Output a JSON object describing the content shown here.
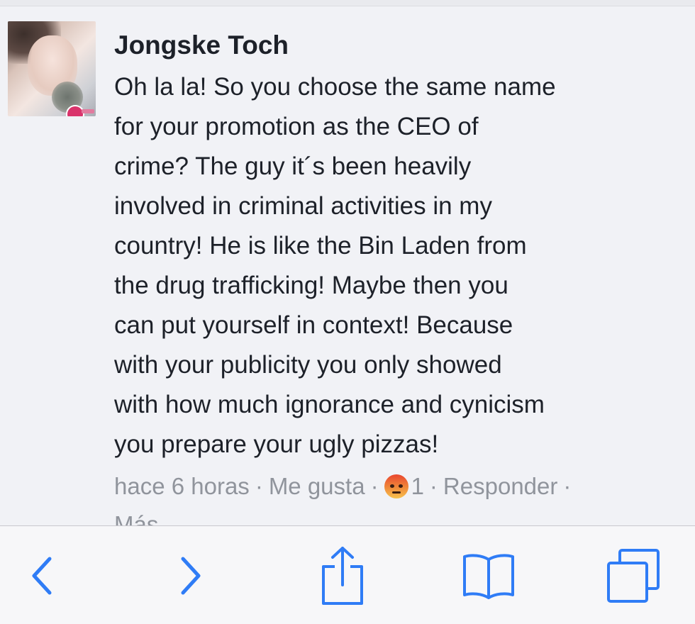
{
  "comment": {
    "author": "Jongske Toch",
    "text_lines": [
      "Oh la la! So you choose the same name",
      "for your promotion as the CEO of",
      "crime? The guy it´s been heavily",
      "involved in criminal activities in my",
      "country! He is like the Bin Laden from",
      "the drug trafficking! Maybe then you",
      "can put yourself in context! Because",
      "with your publicity you only showed",
      "with how much ignorance and cynicism",
      "you prepare your ugly pizzas!"
    ],
    "meta": {
      "timestamp": "hace 6 horas",
      "separator": "·",
      "like_label": "Me gusta",
      "reaction_icon": "angry-face-icon",
      "reaction_count": "1",
      "reply_label": "Responder",
      "more_label": "Más"
    }
  },
  "toolbar": {
    "icons": [
      "back-icon",
      "forward-icon",
      "share-icon",
      "bookmarks-icon",
      "tabs-icon"
    ],
    "accent_color": "#2f7cf6"
  },
  "colors": {
    "text": "#1d2129",
    "meta": "#90949c",
    "background": "#f1f2f6"
  }
}
